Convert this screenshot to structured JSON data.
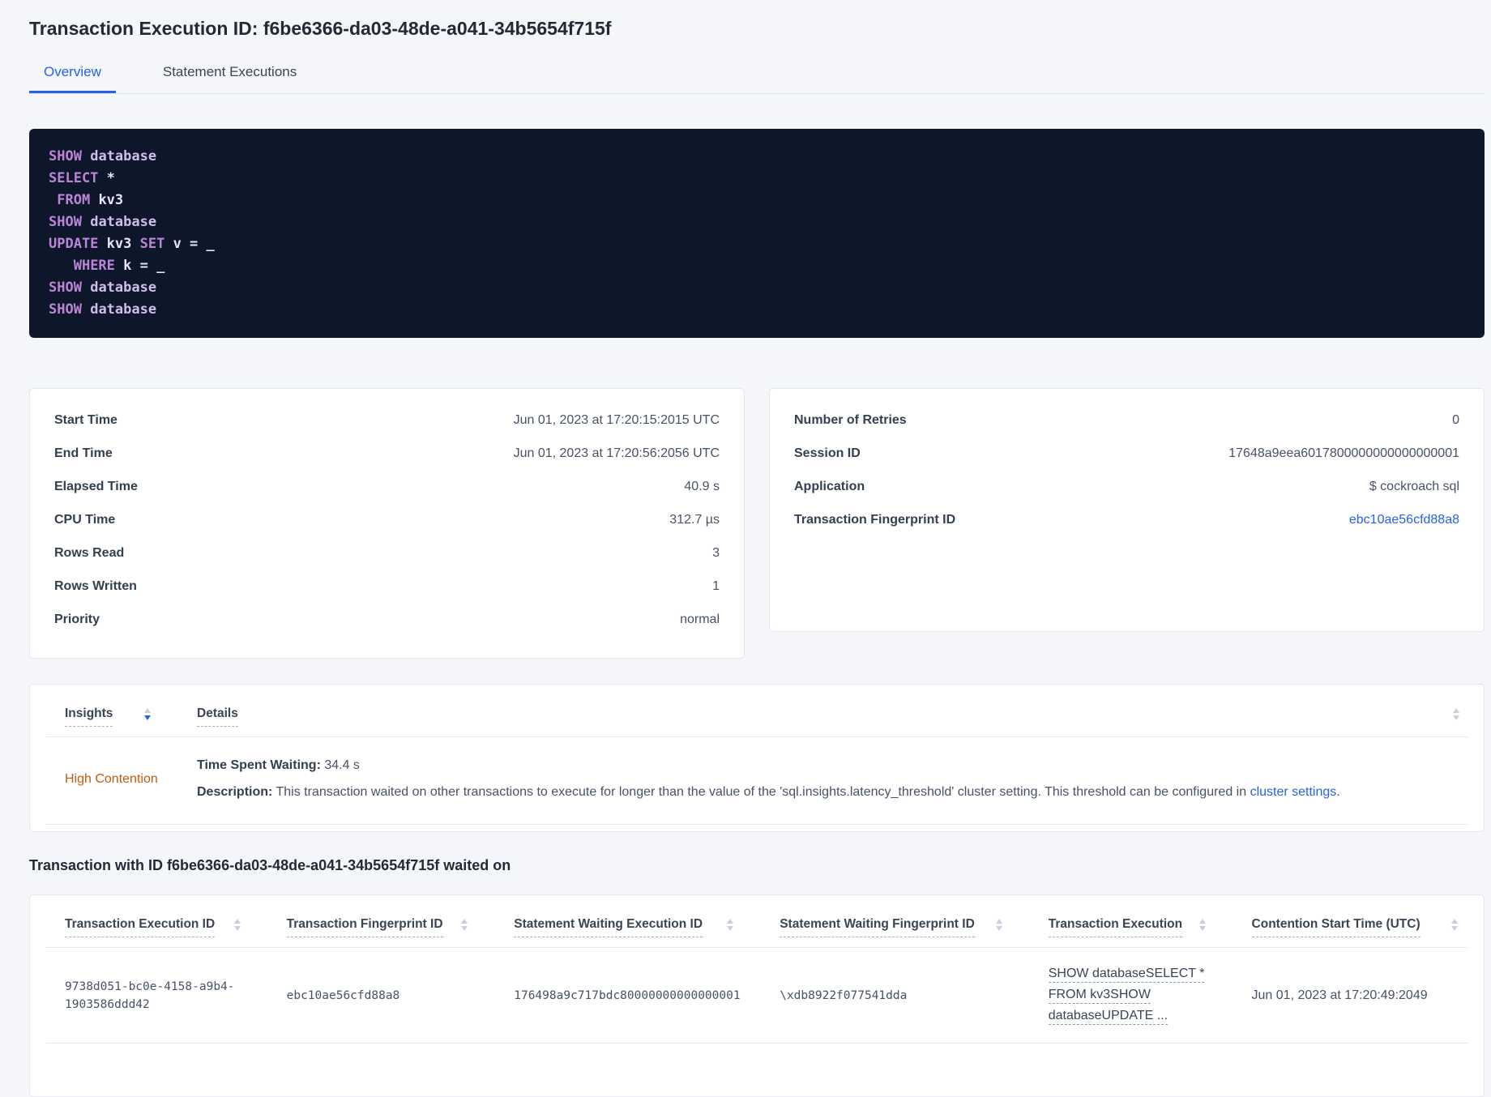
{
  "colors": {
    "accent_blue": "#2761e8",
    "insight_orange": "#bf5b10",
    "code_background": "#0d1729",
    "code_keyword_purple": "#bd85d9",
    "code_name_lavender": "#cfbeec",
    "code_plain": "#e8e6f2",
    "page_background": "#f4f6fa"
  },
  "header": {
    "title": "Transaction Execution ID: f6be6366-da03-48de-a041-34b5654f715f"
  },
  "tabs": [
    {
      "label": "Overview",
      "active": true
    },
    {
      "label": "Statement Executions",
      "active": false
    }
  ],
  "sql": {
    "lines": [
      [
        {
          "t": "SHOW",
          "c": "kw"
        },
        {
          "t": " ",
          "c": "pl"
        },
        {
          "t": "database",
          "c": "id"
        }
      ],
      [
        {
          "t": "SELECT",
          "c": "kw"
        },
        {
          "t": " *",
          "c": "pl"
        }
      ],
      [
        {
          "t": " ",
          "c": "pl"
        },
        {
          "t": "FROM",
          "c": "kw"
        },
        {
          "t": " kv3",
          "c": "pl"
        }
      ],
      [
        {
          "t": "SHOW",
          "c": "kw"
        },
        {
          "t": " ",
          "c": "pl"
        },
        {
          "t": "database",
          "c": "id"
        }
      ],
      [
        {
          "t": "UPDATE",
          "c": "kw"
        },
        {
          "t": " kv3 ",
          "c": "pl"
        },
        {
          "t": "SET",
          "c": "kw"
        },
        {
          "t": " v = _",
          "c": "pl"
        }
      ],
      [
        {
          "t": "   ",
          "c": "pl"
        },
        {
          "t": "WHERE",
          "c": "kw"
        },
        {
          "t": " k = _",
          "c": "pl"
        }
      ],
      [
        {
          "t": "SHOW",
          "c": "kw"
        },
        {
          "t": " ",
          "c": "pl"
        },
        {
          "t": "database",
          "c": "id"
        }
      ],
      [
        {
          "t": "SHOW",
          "c": "kw"
        },
        {
          "t": " ",
          "c": "pl"
        },
        {
          "t": "database",
          "c": "id"
        }
      ]
    ]
  },
  "summary_left": {
    "rows": [
      {
        "label": "Start Time",
        "value": "Jun 01, 2023 at 17:20:15:2015 UTC"
      },
      {
        "label": "End Time",
        "value": "Jun 01, 2023 at 17:20:56:2056 UTC"
      },
      {
        "label": "Elapsed Time",
        "value": "40.9 s"
      },
      {
        "label": "CPU Time",
        "value": "312.7 µs"
      },
      {
        "label": "Rows Read",
        "value": "3"
      },
      {
        "label": "Rows Written",
        "value": "1"
      },
      {
        "label": "Priority",
        "value": "normal"
      }
    ]
  },
  "summary_right": {
    "rows": [
      {
        "label": "Number of Retries",
        "value": "0"
      },
      {
        "label": "Session ID",
        "value": "17648a9eea6017800000000000000001"
      },
      {
        "label": "Application",
        "value": "$ cockroach sql"
      },
      {
        "label": "Transaction Fingerprint ID",
        "value": "ebc10ae56cfd88a8",
        "link": true
      }
    ]
  },
  "insights": {
    "columns": [
      {
        "label": "Insights",
        "sorted": "desc"
      },
      {
        "label": "Details",
        "sorted": "none"
      }
    ],
    "row": {
      "insight": "High Contention",
      "waiting_label": "Time Spent Waiting:",
      "waiting_value": " 34.4 s",
      "description_label": "Description:",
      "description_text": " This transaction waited on other transactions to execute for longer than the value of the 'sql.insights.latency_threshold' cluster setting. This threshold can be configured in ",
      "description_link": "cluster settings",
      "description_suffix": "."
    }
  },
  "waited_section": {
    "heading": "Transaction with ID f6be6366-da03-48de-a041-34b5654f715f waited on",
    "columns": [
      "Transaction Execution ID",
      "Transaction Fingerprint ID",
      "Statement Waiting Execution ID",
      "Statement Waiting Fingerprint ID",
      "Transaction Execution",
      "Contention Start Time (UTC)"
    ],
    "row": {
      "transaction_execution_id": "9738d051-bc0e-4158-a9b4-1903586ddd42",
      "transaction_fingerprint_id": "ebc10ae56cfd88a8",
      "statement_waiting_execution_id": "176498a9c717bdc80000000000000001",
      "statement_waiting_fingerprint_id": "\\xdb8922f077541dda",
      "transaction_execution_lines": [
        "SHOW databaseSELECT *",
        "FROM kv3SHOW",
        "databaseUPDATE ..."
      ],
      "contention_start_time": "Jun 01, 2023 at 17:20:49:2049"
    }
  }
}
